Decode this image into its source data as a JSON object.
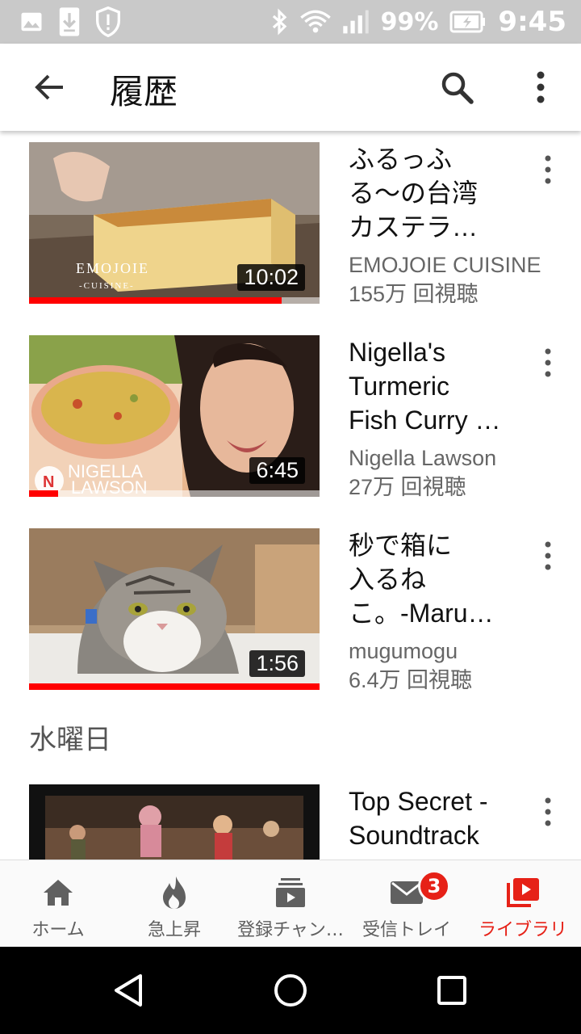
{
  "status_bar": {
    "battery": "99%",
    "time": "9:45",
    "icons": [
      "image-icon",
      "download-icon",
      "shield-icon",
      "bluetooth-icon",
      "wifi-icon",
      "signal-icon",
      "battery-charging-icon"
    ]
  },
  "app_bar": {
    "title": "履歴"
  },
  "videos": [
    {
      "title": "ふるっふる〜の台湾カステラ…",
      "title_lines": [
        "ふるっふ",
        "る〜の台湾",
        "カステラ…"
      ],
      "channel": "EMOJOIE CUISINE",
      "views": "155万 回視聴",
      "duration": "10:02",
      "watched_fraction": 0.87,
      "thumb_caption": "EMOJOIE",
      "thumb_caption2": "-CUISINE-"
    },
    {
      "title": "Nigella's Turmeric Fish Curry …",
      "title_lines": [
        "Nigella's",
        "Turmeric",
        "Fish Curry …"
      ],
      "channel": "Nigella Lawson",
      "views": "27万 回視聴",
      "duration": "6:45",
      "watched_fraction": 0.1,
      "thumb_caption": "NIGELLA",
      "thumb_caption2": "LAWSON"
    },
    {
      "title": "秒で箱に入るねこ。-Maru…",
      "title_lines": [
        "秒で箱に",
        "入るね",
        "こ。-Maru…"
      ],
      "channel": "mugumogu",
      "views": "6.4万 回視聴",
      "duration": "1:56",
      "watched_fraction": 1.0
    }
  ],
  "section_header": "水曜日",
  "partial_video": {
    "title_lines": [
      "Top Secret -",
      "Soundtrack"
    ]
  },
  "bottom_nav": [
    {
      "label": "ホーム",
      "icon": "home-icon",
      "active": false
    },
    {
      "label": "急上昇",
      "icon": "trending-flame-icon",
      "active": false
    },
    {
      "label": "登録チャン…",
      "icon": "subscriptions-icon",
      "active": false
    },
    {
      "label": "受信トレイ",
      "icon": "inbox-mail-icon",
      "active": false,
      "badge": "3"
    },
    {
      "label": "ライブラリ",
      "icon": "library-icon",
      "active": true
    }
  ],
  "colors": {
    "accent": "#e62117",
    "progress": "#ff0000",
    "status_bar": "#c9c9c9"
  }
}
